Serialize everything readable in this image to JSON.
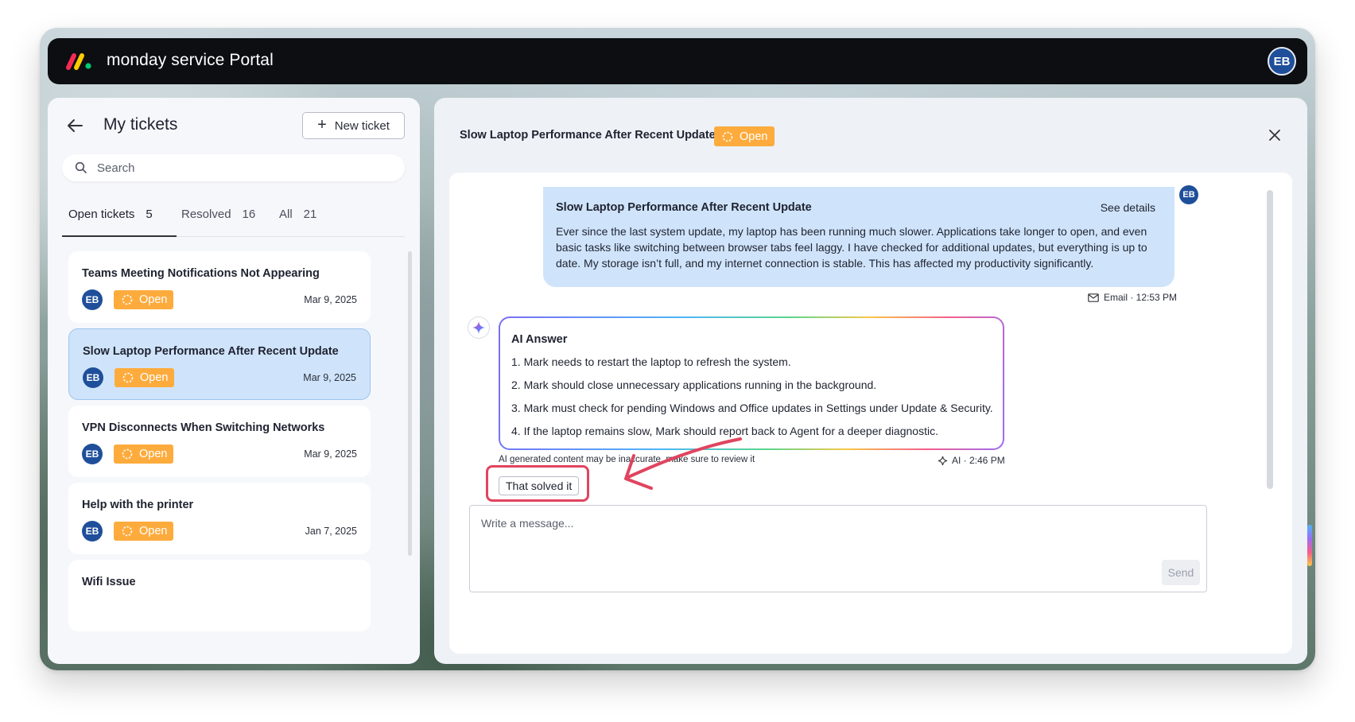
{
  "app": {
    "brand": "monday service Portal",
    "user_initials": "EB"
  },
  "left_panel": {
    "title": "My tickets",
    "new_ticket_label": "New ticket",
    "search_placeholder": "Search",
    "tabs": [
      {
        "label": "Open tickets",
        "count": "5"
      },
      {
        "label": "Resolved",
        "count": "16"
      },
      {
        "label": "All",
        "count": "21"
      }
    ],
    "tickets": [
      {
        "title": "Teams Meeting Notifications Not Appearing",
        "initials": "EB",
        "status": "Open",
        "date": "Mar 9, 2025"
      },
      {
        "title": "Slow Laptop Performance After Recent Update",
        "initials": "EB",
        "status": "Open",
        "date": "Mar 9, 2025"
      },
      {
        "title": "VPN Disconnects When Switching Networks",
        "initials": "EB",
        "status": "Open",
        "date": "Mar 9, 2025"
      },
      {
        "title": "Help with the printer",
        "initials": "EB",
        "status": "Open",
        "date": "Jan 7, 2025"
      },
      {
        "title": "Wifi Issue",
        "initials": "",
        "status": "",
        "date": ""
      }
    ]
  },
  "detail": {
    "title": "Slow Laptop Performance After Recent Update",
    "status": "Open",
    "message": {
      "title": "Slow Laptop Performance After Recent Update",
      "see_details": "See details",
      "body": "Ever since the last system update, my laptop has been running much slower. Applications take longer to open, and even basic tasks like switching between browser tabs feel laggy. I have checked for additional updates, but everything is up to date. My storage isn’t full, and my internet connection is stable. This has affected my productivity significantly.",
      "initials": "EB",
      "meta": "Email · 12:53 PM"
    },
    "ai_answer": {
      "title": "AI Answer",
      "items": [
        "1. Mark needs to restart the laptop to refresh the system.",
        "2. Mark should close unnecessary applications running in the background.",
        "3. Mark must check for pending Windows and Office updates in Settings under Update & Security.",
        "4. If the laptop remains slow, Mark should report back to Agent for a deeper diagnostic."
      ],
      "disclaimer": "AI generated content may be inaccurate, make sure to review it",
      "meta": "AI · 2:46 PM",
      "solved_label": "That solved it"
    },
    "composer_placeholder": "Write a message...",
    "send_label": "Send"
  },
  "colors": {
    "status_open": "#fdab3d",
    "selected_card": "#cfe4fb",
    "avatar": "#1f4f9a",
    "highlight": "#e0445f",
    "topbar": "#0d0e12"
  }
}
